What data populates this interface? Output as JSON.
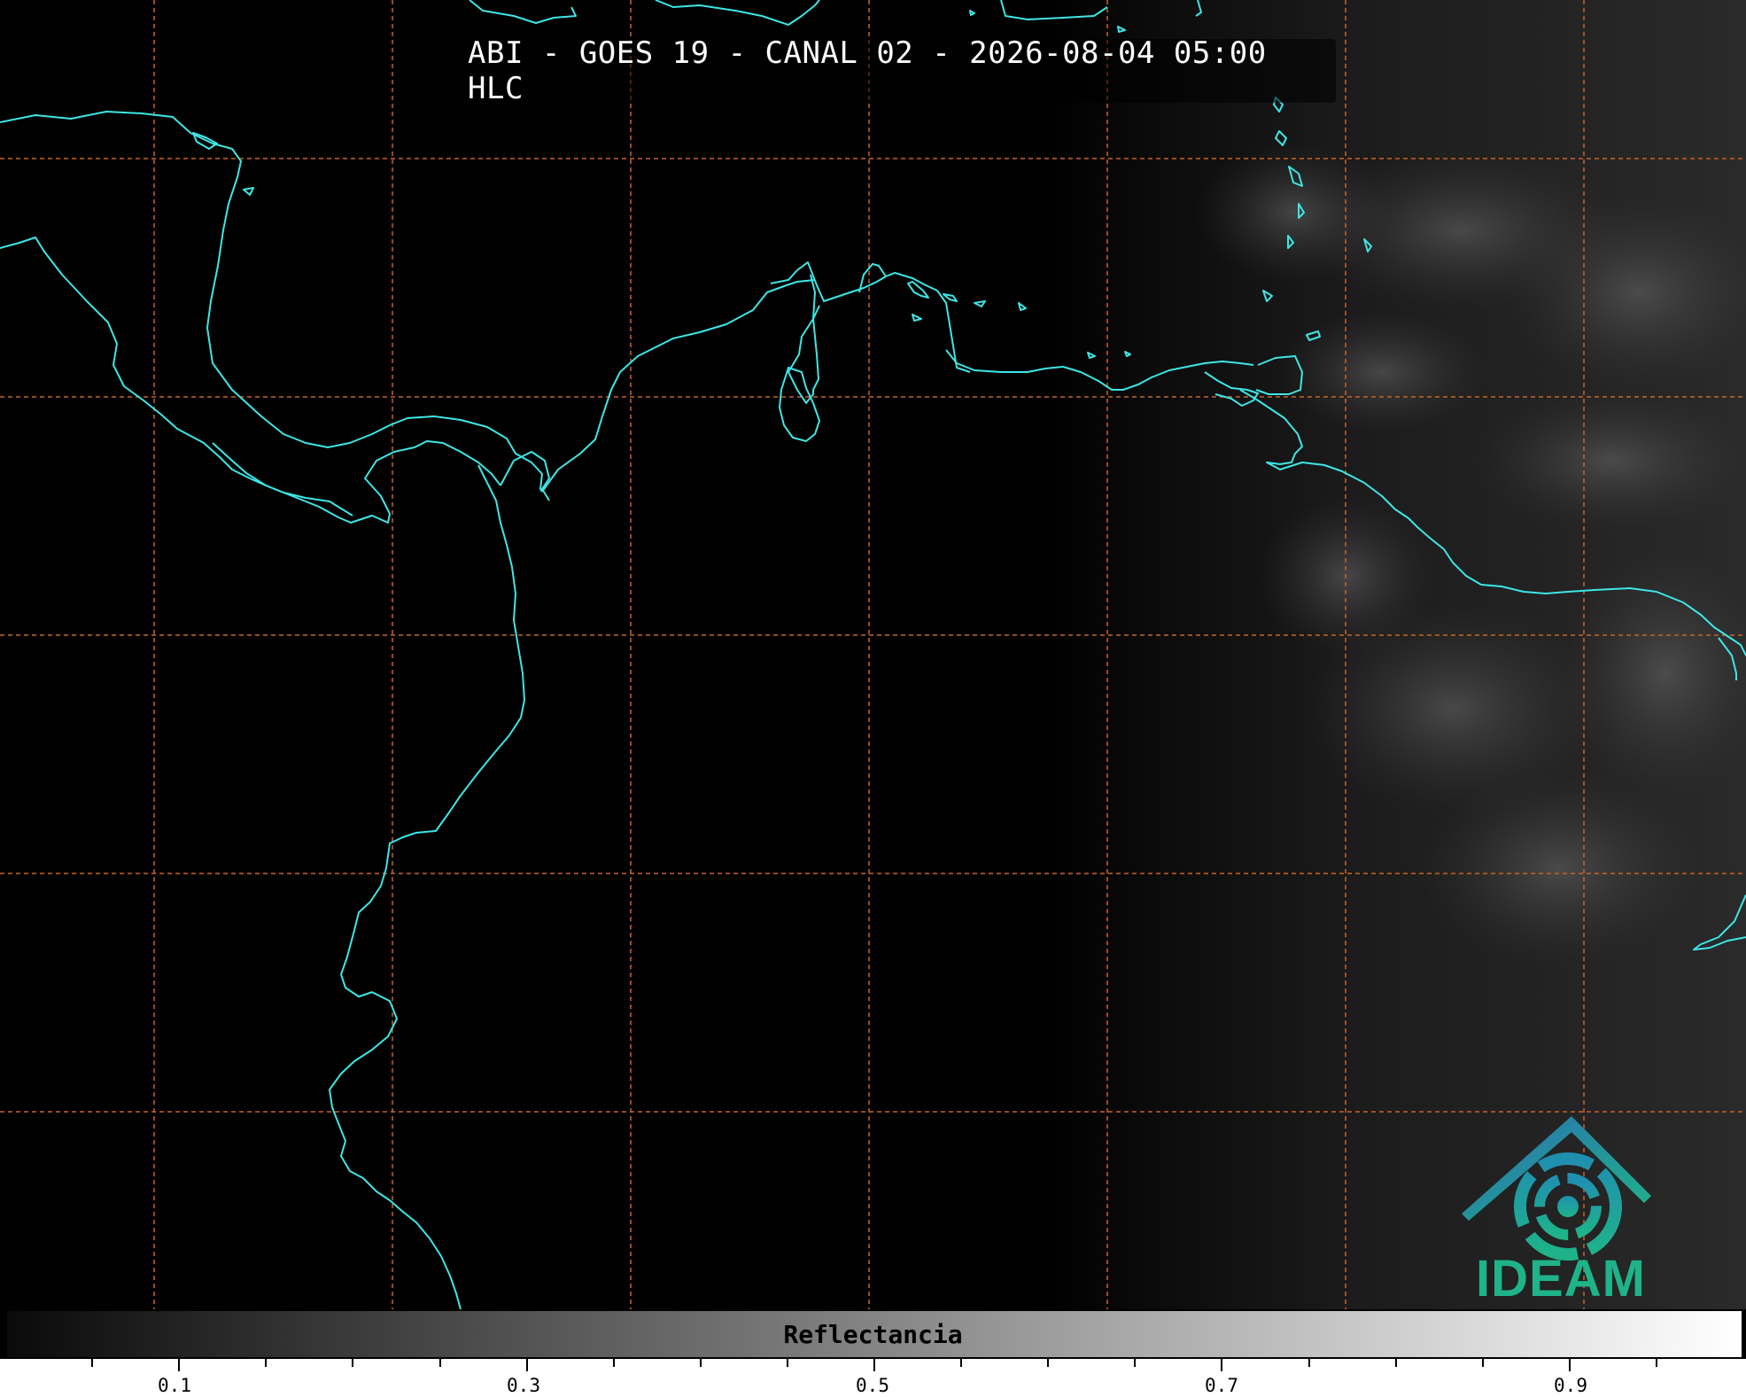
{
  "map": {
    "title": "ABI - GOES 19 - CANAL 02 - 2026-08-04 05:00 HLC",
    "coastline_color": "#3ee6e6",
    "graticule_color": "#c8632a",
    "background_color": "#000000"
  },
  "logo": {
    "text": "IDEAM",
    "text_color": "#1fb389",
    "roof_color": "#2a6fb0"
  },
  "colorbar": {
    "label": "Reflectancia",
    "range": [
      0.0,
      1.0
    ],
    "major_ticks": [
      "0.1",
      "0.3",
      "0.5",
      "0.7",
      "0.9"
    ],
    "colormap": "gray"
  }
}
